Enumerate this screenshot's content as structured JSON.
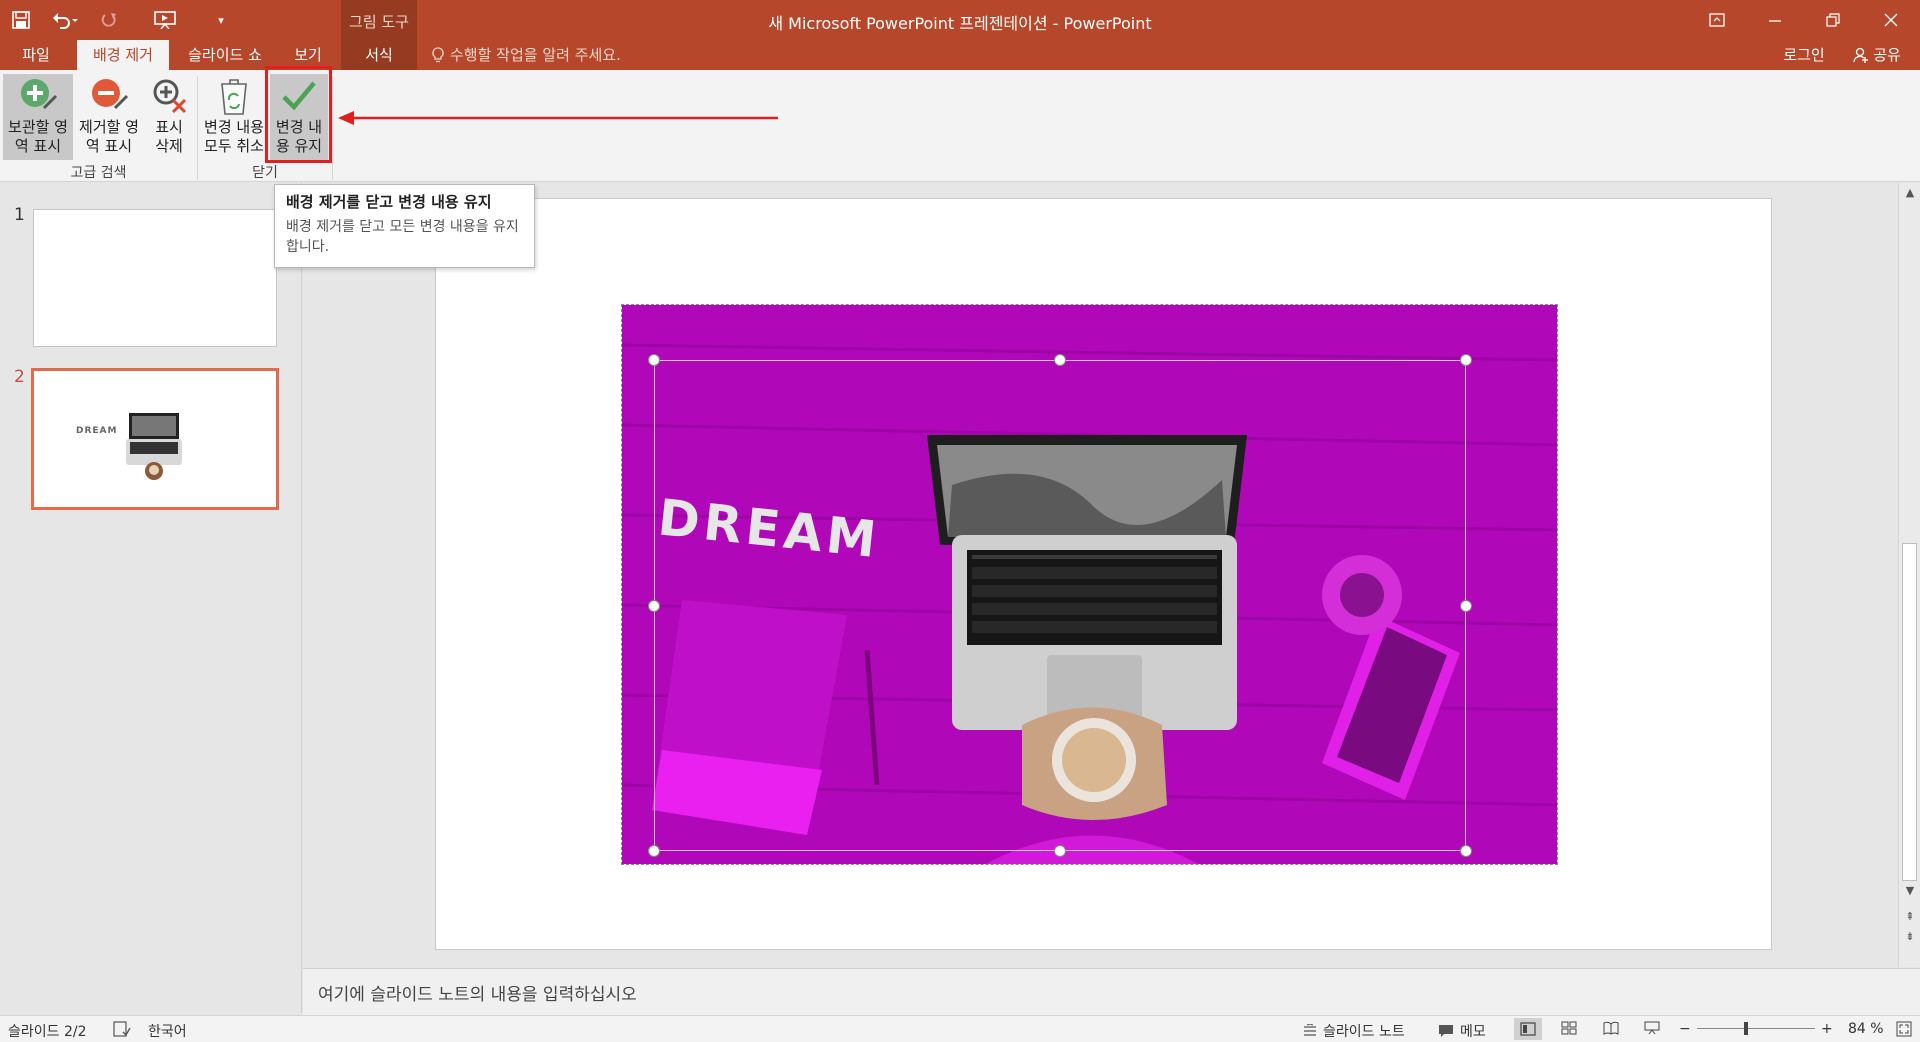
{
  "window": {
    "title": "새 Microsoft PowerPoint 프레젠테이션 - PowerPoint",
    "contextual_group": "그림 도구",
    "tell_me": "수행할 작업을 알려 주세요.",
    "login": "로그인",
    "share": "공유"
  },
  "tabs": [
    {
      "label": "파일"
    },
    {
      "label": "배경 제거",
      "active": true
    },
    {
      "label": "슬라이드 쇼"
    },
    {
      "label": "보기"
    },
    {
      "label": "서식"
    }
  ],
  "ribbon": {
    "mark_keep": {
      "line1": "보관할 영",
      "line2": "역 표시",
      "icon": "plus-pencil-icon"
    },
    "mark_remove": {
      "line1": "제거할 영",
      "line2": "역 표시",
      "icon": "minus-pencil-icon"
    },
    "delete_mark": {
      "line1": "표시",
      "line2": "삭제",
      "icon": "delete-mark-icon"
    },
    "discard_all": {
      "line1": "변경 내용",
      "line2": "모두 취소",
      "icon": "recycle-bin-icon"
    },
    "keep_changes": {
      "line1": "변경 내",
      "line2": "용 유지",
      "icon": "checkmark-icon"
    },
    "group_refine": "고급 검색",
    "group_close": "닫기"
  },
  "tooltip": {
    "title": "배경 제거를 닫고 변경 내용 유지",
    "body": "배경 제거를 닫고 모든 변경 내용을 유지합니다."
  },
  "slides": [
    {
      "number": "1"
    },
    {
      "number": "2",
      "selected": true,
      "thumb_text": "DREAM"
    }
  ],
  "slide_image": {
    "dream_letters": "DREAM",
    "highlight_color": "#c000c8"
  },
  "notes": {
    "placeholder": "여기에 슬라이드 노트의 내용을 입력하십시오"
  },
  "status": {
    "slide_counter": "슬라이드 2/2",
    "language": "한국어",
    "notes_btn": "슬라이드 노트",
    "comments_btn": "메모",
    "zoom": "84 %"
  },
  "colors": {
    "accent": "#b7472a",
    "annotation": "#e02020"
  }
}
